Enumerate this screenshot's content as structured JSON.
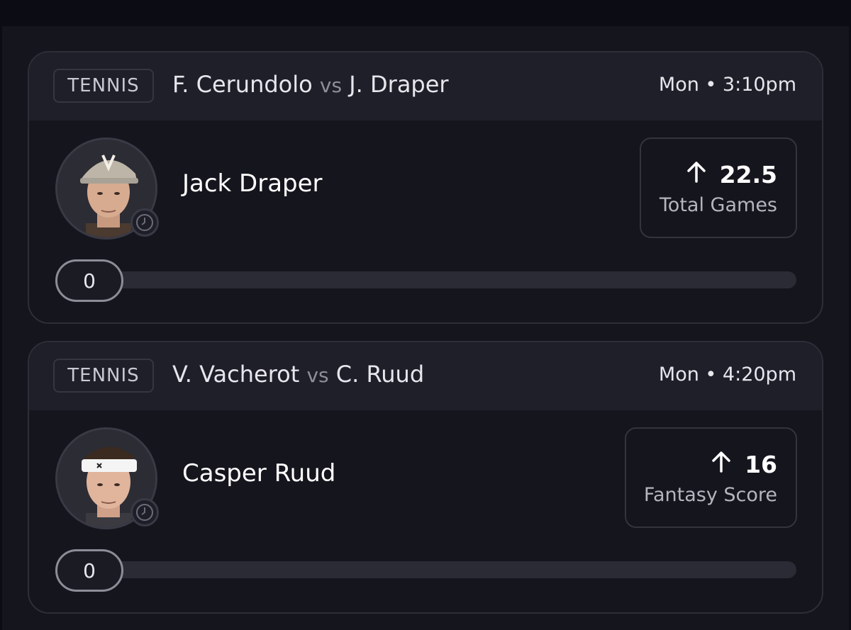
{
  "cards": [
    {
      "sport": "TENNIS",
      "team_a": "F. Cerundolo",
      "vs": "vs",
      "team_b": "J. Draper",
      "when": "Mon • 3:10pm",
      "player": "Jack Draper",
      "direction_icon": "arrow-up-icon",
      "stat_value": "22.5",
      "stat_label": "Total Games",
      "progress_value": "0",
      "progress_fraction": 0
    },
    {
      "sport": "TENNIS",
      "team_a": "V. Vacherot",
      "vs": "vs",
      "team_b": "C. Ruud",
      "when": "Mon • 4:20pm",
      "player": "Casper Ruud",
      "direction_icon": "arrow-up-icon",
      "stat_value": "16",
      "stat_label": "Fantasy Score",
      "progress_value": "0",
      "progress_fraction": 0
    }
  ],
  "colors": {
    "background": "#15151d",
    "card_header": "#1f1f29",
    "border": "#2e2e38",
    "muted_text": "#b5b5bf"
  }
}
